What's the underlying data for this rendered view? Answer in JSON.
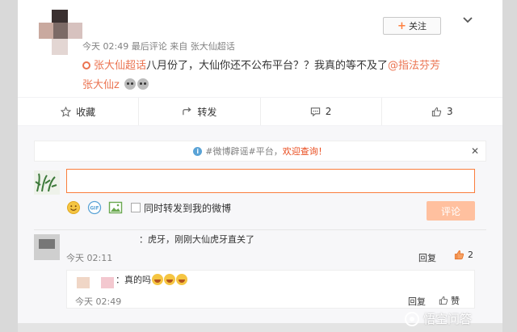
{
  "post": {
    "meta_time": "今天 02:49",
    "meta_extra": "最后评论",
    "meta_source": "来自 张大仙超话",
    "follow_label": "关注",
    "content": {
      "topic": "张大仙超话",
      "text": "八月份了，大仙你还不公布平台？？我真的等不及了",
      "mention1": "@指法芬芳",
      "mention2": "张大仙z"
    }
  },
  "actions": [
    {
      "icon": "star-icon",
      "label": "收藏"
    },
    {
      "icon": "forward-icon",
      "label": "转发"
    },
    {
      "icon": "comment-icon",
      "label": "2"
    },
    {
      "icon": "like-icon",
      "label": "3"
    }
  ],
  "notice": {
    "prefix": "#微博辟谣#平台，",
    "highlight": "欢迎查询！"
  },
  "composer": {
    "sync_label": "同时转发到我的微博",
    "submit_label": "评论"
  },
  "comments": [
    {
      "text": "：虎牙，刚刚大仙虎牙直关了",
      "time": "今天 02:11",
      "reply_label": "回复",
      "likes": "2",
      "replies": [
        {
          "text": "：真的吗",
          "time": "今天 02:49",
          "reply_label": "回复",
          "like_label": "赞"
        }
      ]
    }
  ],
  "watermark": "悟空问答",
  "colors": {
    "accent": "#eb7350",
    "submit_disabled": "#ffc09f",
    "input_border": "#fa7d3c",
    "notice_red": "#e94b1d"
  }
}
